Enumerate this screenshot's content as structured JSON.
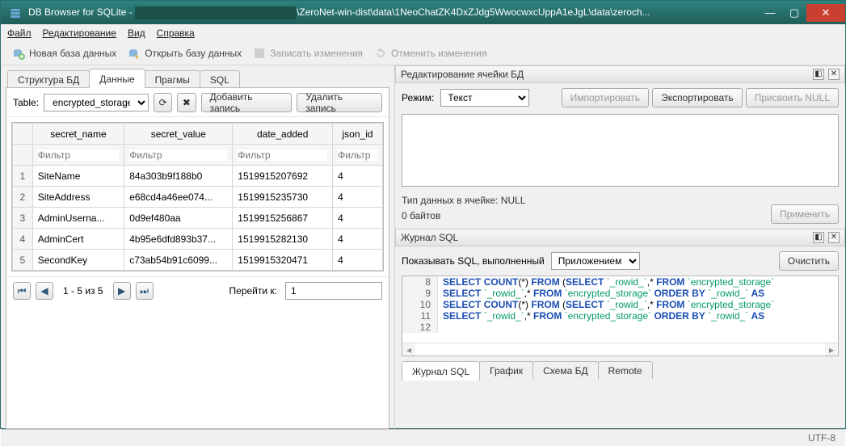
{
  "window": {
    "title_prefix": "DB Browser for SQLite - ",
    "title_suffix": "\\ZeroNet-win-dist\\data\\1NeoChatZK4DxZJdg5WwocwxcUppA1eJgL\\data\\zeroch..."
  },
  "menu": {
    "file": "Файл",
    "edit": "Редактирование",
    "view": "Вид",
    "help": "Справка"
  },
  "toolbar": {
    "new": "Новая база данных",
    "open": "Открыть базу данных",
    "save": "Записать изменения",
    "revert": "Отменить изменения"
  },
  "left": {
    "tabs": [
      "Структура БД",
      "Данные",
      "Прагмы",
      "SQL"
    ],
    "active_tab_index": 1,
    "table_label": "Table:",
    "table_selected": "encrypted_storage",
    "add_label": "Добавить запись",
    "delete_label": "Удалить запись",
    "filter_placeholder": "Фильтр",
    "columns": [
      "secret_name",
      "secret_value",
      "date_added",
      "json_id"
    ],
    "rows": [
      [
        "SiteName",
        "84a303b9f188b0",
        "1519915207692",
        "4"
      ],
      [
        "SiteAddress",
        "e68cd4a46ee074...",
        "1519915235730",
        "4"
      ],
      [
        "AdminUserna...",
        "0d9ef480aa",
        "1519915256867",
        "4"
      ],
      [
        "AdminCert",
        "4b95e6dfd893b37...",
        "1519915282130",
        "4"
      ],
      [
        "SecondKey",
        "c73ab54b91c6099...",
        "1519915320471",
        "4"
      ]
    ],
    "pager": {
      "count": "1 - 5 из 5",
      "goto_label": "Перейти к:",
      "goto_value": "1"
    }
  },
  "right": {
    "edit_title": "Редактирование ячейки БД",
    "mode_label": "Режим:",
    "mode_value": "Текст",
    "import_label": "Импортировать",
    "export_label": "Экспортировать",
    "null_label": "Присвоить NULL",
    "cell_type": "Тип данных в ячейке: NULL",
    "cell_size": "0 байтов",
    "apply_label": "Применить",
    "sqllog_title": "Журнал SQL",
    "show_label": "Показывать SQL, выполненный",
    "show_value": "Приложением",
    "clear_label": "Очистить",
    "sql_lines": [
      {
        "n": 8,
        "raw": "SELECT COUNT(*) FROM (SELECT `_rowid_`,* FROM `encrypted_storage`"
      },
      {
        "n": 9,
        "raw": "SELECT `_rowid_`,* FROM `encrypted_storage` ORDER BY `_rowid_` AS"
      },
      {
        "n": 10,
        "raw": "SELECT COUNT(*) FROM (SELECT `_rowid_`,* FROM `encrypted_storage`"
      },
      {
        "n": 11,
        "raw": "SELECT `_rowid_`,* FROM `encrypted_storage` ORDER BY `_rowid_` AS"
      },
      {
        "n": 12,
        "raw": ""
      }
    ],
    "bottom_tabs": [
      "Журнал SQL",
      "График",
      "Схема БД",
      "Remote"
    ],
    "bottom_active": 0
  },
  "statusbar": {
    "encoding": "UTF-8"
  }
}
